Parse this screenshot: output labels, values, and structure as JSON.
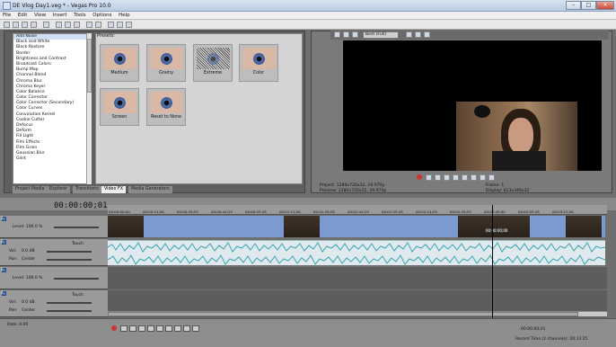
{
  "window": {
    "title": "DE Vlog Day1.veg * - Vegas Pro 10.0",
    "controls": [
      "–",
      "□",
      "✕"
    ]
  },
  "menu": [
    "File",
    "Edit",
    "View",
    "Insert",
    "Tools",
    "Options",
    "Help"
  ],
  "effects": {
    "list": [
      "Add Noise",
      "Black and White",
      "Black Restore",
      "Border",
      "Brightness and Contrast",
      "Broadcast Colors",
      "Bump Map",
      "Channel Blend",
      "Chroma Blur",
      "Chroma Keyer",
      "Color Balance",
      "Color Corrector",
      "Color Corrector (Secondary)",
      "Color Curves",
      "Convolution Kernel",
      "Cookie Cutter",
      "Defocus",
      "Deform",
      "Fill Light",
      "Film Effects",
      "Film Grain",
      "Gaussian Blur",
      "Glint"
    ],
    "selected_index": 0,
    "presets_label": "Presets:",
    "presets": [
      "Medium",
      "Grainy",
      "Extreme",
      "Color",
      "Screen",
      "Reset to None"
    ]
  },
  "tabs": [
    "Project Media",
    "Explorer",
    "Transitions",
    "Video FX",
    "Media Generators"
  ],
  "active_tab_index": 3,
  "preview": {
    "quality": "Best (Full)",
    "project_label": "Project:",
    "project_value": "1280x720x32, 29.970p",
    "preview_label": "Preview:",
    "preview_value": "1280x720x32, 29.970p",
    "frame_label": "Frame:",
    "frame_value": "1",
    "display_label": "Display:",
    "display_value": "613x346x32"
  },
  "timeline": {
    "timecode": "00:00:00;01",
    "ruler": [
      "00:00:00;00",
      "00:00:15;00",
      "00:00:29;29",
      "00:00:44;29",
      "00:00:59;28",
      "00:01:15;00",
      "00:01:29;28",
      "00:01:44;29",
      "00:01:59;28",
      "00:02:14;29",
      "00:02:29;29",
      "00:02:45;00",
      "00:02:59;28",
      "00:03:15;00"
    ],
    "tracks": [
      {
        "num": "1",
        "kind": "video",
        "level": "Level: 100.0 %"
      },
      {
        "num": "2",
        "kind": "audio",
        "vol": "Vol:",
        "vol_value": "0.0 dB",
        "pan": "Pan:",
        "pan_value": "Center",
        "mode": "Touch"
      },
      {
        "num": "3",
        "kind": "video",
        "level": "Level: 100.0 %"
      },
      {
        "num": "4",
        "kind": "audio",
        "vol": "Vol:",
        "vol_value": "0.0 dB",
        "pan": "Pan:",
        "pan_value": "Center",
        "mode": "Touch"
      }
    ],
    "clip_label": "00:00:00;00",
    "rate": "Rate: 0.00"
  },
  "footer": {
    "end_time": "00:00:00;01",
    "status": "Record Time (2 channels): 20:13:25"
  },
  "colors": {
    "video_clip": "#7a9ad0",
    "audio_clip": "#dfe9ee",
    "wave": "#3aa6b0",
    "cursor": "#000000"
  }
}
